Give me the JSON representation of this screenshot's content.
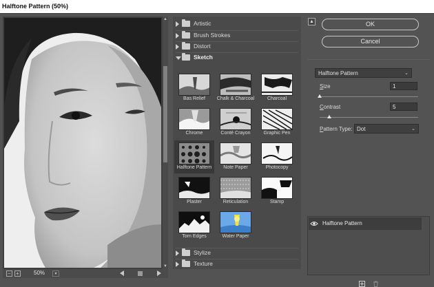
{
  "window": {
    "title": "Halftone Pattern (50%)"
  },
  "preview": {
    "zoom_label": "50%",
    "zoom_minus": "−",
    "zoom_plus": "+"
  },
  "categories_top": [
    {
      "label": "Artistic"
    },
    {
      "label": "Brush Strokes"
    },
    {
      "label": "Distort"
    },
    {
      "label": "Sketch"
    }
  ],
  "categories_bottom": [
    {
      "label": "Stylize"
    },
    {
      "label": "Texture"
    }
  ],
  "sketch_filters": [
    {
      "label": "Bas Relief"
    },
    {
      "label": "Chalk & Charcoal"
    },
    {
      "label": "Charcoal"
    },
    {
      "label": "Chrome"
    },
    {
      "label": "Conté Crayon"
    },
    {
      "label": "Graphic Pen"
    },
    {
      "label": "Halftone Pattern",
      "selected": true
    },
    {
      "label": "Note Paper"
    },
    {
      "label": "Photocopy"
    },
    {
      "label": "Plaster"
    },
    {
      "label": "Reticulation"
    },
    {
      "label": "Stamp"
    },
    {
      "label": "Torn Edges"
    },
    {
      "label": "Water Paper"
    }
  ],
  "buttons": {
    "ok": "OK",
    "cancel": "Cancel"
  },
  "settings": {
    "filter": "Halftone Pattern",
    "size_label": "Size",
    "size_value": "1",
    "contrast_label": "Contrast",
    "contrast_value": "5",
    "pattern_type_label": "Pattern Type:",
    "pattern_type_value": "Dot",
    "size_level": 0.0,
    "contrast_level": 0.1
  },
  "layers": [
    {
      "name": "Halftone Pattern",
      "visible": true
    }
  ],
  "colors": {
    "panel": "#535353",
    "list": "#4a4a4a",
    "selected": "#383838"
  }
}
